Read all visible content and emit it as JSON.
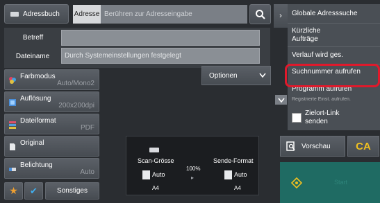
{
  "top": {
    "addressbook_label": "Adressbuch",
    "address_tab_label": "Adresse",
    "address_placeholder": "Berühren zur Adresseingabe"
  },
  "fields": {
    "subject_label": "Betreff",
    "subject_value": "",
    "filename_label": "Dateiname",
    "filename_placeholder": "Durch Systemeinstellungen festgelegt"
  },
  "options_label": "Optionen",
  "settings": [
    {
      "label": "Farbmodus",
      "value": "Auto/Mono2"
    },
    {
      "label": "Auflösung",
      "value": "200x200dpi"
    },
    {
      "label": "Dateiformat",
      "value": "PDF"
    },
    {
      "label": "Original",
      "value": ""
    },
    {
      "label": "Belichtung",
      "value": "Auto"
    }
  ],
  "bottom": {
    "other_label": "Sonstiges"
  },
  "preview_panel": {
    "scan_size_label": "Scan-Grösse",
    "scan_size_value": "Auto",
    "scan_size_paper": "A4",
    "ratio": "100%",
    "send_format_label": "Sende-Format",
    "send_format_value": "Auto",
    "send_format_paper": "A4"
  },
  "menu": {
    "items": {
      "global_search": "Globale Adresssuche",
      "recent_jobs": "Kürzliche Aufträge",
      "history": "Verlauf wird ges.",
      "search_number": "Suchnummer aufrufen",
      "program": "Programm aufrufen",
      "registered": "Registrierte Einst. aufrufen.",
      "target_link": "Zielort-Link senden"
    }
  },
  "preview_label": "Vorschau",
  "ca_label": "CA",
  "start_label": "Start",
  "colors": {
    "highlight": "#e0192b",
    "ca_text": "#f0c020",
    "start_bg": "#1f6b63"
  }
}
